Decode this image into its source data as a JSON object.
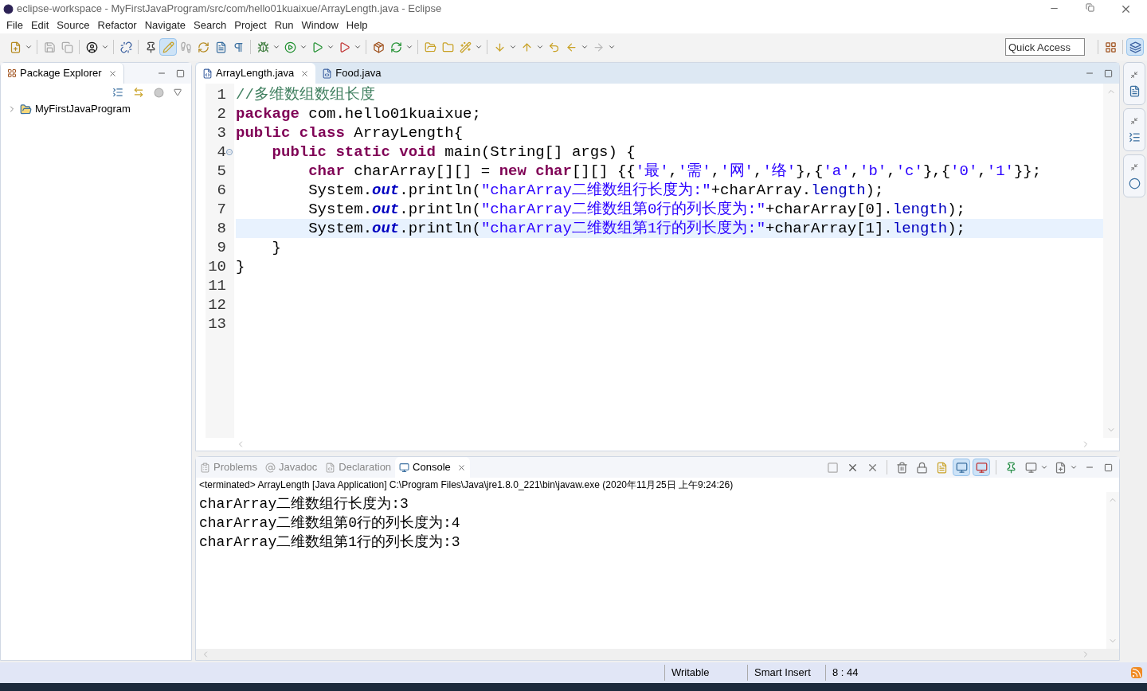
{
  "window": {
    "title": "eclipse-workspace - MyFirstJavaProgram/src/com/hello01kuaixue/ArrayLength.java - Eclipse"
  },
  "menu": [
    "File",
    "Edit",
    "Source",
    "Refactor",
    "Navigate",
    "Search",
    "Project",
    "Run",
    "Window",
    "Help"
  ],
  "quick_access": {
    "placeholder": "Quick Access"
  },
  "package_explorer": {
    "title": "Package Explorer",
    "tree": [
      {
        "label": "MyFirstJavaProgram",
        "expanded": false
      }
    ]
  },
  "editor": {
    "tabs": [
      {
        "label": "ArrayLength.java",
        "selected": true
      },
      {
        "label": "Food.java",
        "selected": false
      }
    ],
    "lines": [
      {
        "number": "1",
        "current": false,
        "foldable": false,
        "tokens": [
          {
            "kind": "comment",
            "text": "//多维数组数组长度"
          }
        ]
      },
      {
        "number": "2",
        "current": false,
        "foldable": false,
        "tokens": [
          {
            "kind": "keyword",
            "text": "package"
          },
          {
            "kind": "plain",
            "text": " com.hello01kuaixue;"
          }
        ]
      },
      {
        "number": "3",
        "current": false,
        "foldable": false,
        "tokens": [
          {
            "kind": "keyword",
            "text": "public"
          },
          {
            "kind": "keyword",
            "text": " class"
          },
          {
            "kind": "plain",
            "text": " ArrayLength{"
          }
        ]
      },
      {
        "number": "4",
        "current": false,
        "foldable": true,
        "tokens": [
          {
            "kind": "keyword",
            "text": "    public"
          },
          {
            "kind": "keyword",
            "text": " static"
          },
          {
            "kind": "keyword",
            "text": " void"
          },
          {
            "kind": "plain",
            "text": " main(String[] args) {"
          }
        ]
      },
      {
        "number": "5",
        "current": false,
        "foldable": false,
        "tokens": [
          {
            "kind": "keyword",
            "text": "        char"
          },
          {
            "kind": "plain",
            "text": " charArray[][] = "
          },
          {
            "kind": "keyword",
            "text": "new"
          },
          {
            "kind": "keyword",
            "text": " char"
          },
          {
            "kind": "plain",
            "text": "[][] {{"
          },
          {
            "kind": "string",
            "text": "'最'"
          },
          {
            "kind": "plain",
            "text": ","
          },
          {
            "kind": "string",
            "text": "'需'"
          },
          {
            "kind": "plain",
            "text": ","
          },
          {
            "kind": "string",
            "text": "'网'"
          },
          {
            "kind": "plain",
            "text": ","
          },
          {
            "kind": "string",
            "text": "'络'"
          },
          {
            "kind": "plain",
            "text": "},{"
          },
          {
            "kind": "string",
            "text": "'a'"
          },
          {
            "kind": "plain",
            "text": ","
          },
          {
            "kind": "string",
            "text": "'b'"
          },
          {
            "kind": "plain",
            "text": ","
          },
          {
            "kind": "string",
            "text": "'c'"
          },
          {
            "kind": "plain",
            "text": "},{"
          },
          {
            "kind": "string",
            "text": "'0'"
          },
          {
            "kind": "plain",
            "text": ","
          },
          {
            "kind": "string",
            "text": "'1'"
          },
          {
            "kind": "plain",
            "text": "}};"
          }
        ]
      },
      {
        "number": "6",
        "current": false,
        "foldable": false,
        "tokens": [
          {
            "kind": "plain",
            "text": "        System."
          },
          {
            "kind": "static_field",
            "text": "out"
          },
          {
            "kind": "plain",
            "text": ".println("
          },
          {
            "kind": "string",
            "text": "\"charArray二维数组行长度为:\""
          },
          {
            "kind": "plain",
            "text": "+charArray."
          },
          {
            "kind": "field",
            "text": "length"
          },
          {
            "kind": "plain",
            "text": ");"
          }
        ]
      },
      {
        "number": "7",
        "current": false,
        "foldable": false,
        "tokens": [
          {
            "kind": "plain",
            "text": "        System."
          },
          {
            "kind": "static_field",
            "text": "out"
          },
          {
            "kind": "plain",
            "text": ".println("
          },
          {
            "kind": "string",
            "text": "\"charArray二维数组第0行的列长度为:\""
          },
          {
            "kind": "plain",
            "text": "+charArray[0]."
          },
          {
            "kind": "field",
            "text": "length"
          },
          {
            "kind": "plain",
            "text": ");"
          }
        ]
      },
      {
        "number": "8",
        "current": true,
        "foldable": false,
        "tokens": [
          {
            "kind": "plain",
            "text": "        System."
          },
          {
            "kind": "static_field",
            "text": "out"
          },
          {
            "kind": "plain",
            "text": ".println("
          },
          {
            "kind": "string",
            "text": "\"charArray二维数组第1行的列长度为:\""
          },
          {
            "kind": "plain",
            "text": "+charArray[1]."
          },
          {
            "kind": "field",
            "text": "length"
          },
          {
            "kind": "plain",
            "text": ");"
          }
        ]
      },
      {
        "number": "9",
        "current": false,
        "foldable": false,
        "tokens": [
          {
            "kind": "plain",
            "text": "    }"
          }
        ]
      },
      {
        "number": "10",
        "current": false,
        "foldable": false,
        "tokens": [
          {
            "kind": "plain",
            "text": "}"
          }
        ]
      },
      {
        "number": "11",
        "current": false,
        "foldable": false
      },
      {
        "number": "12",
        "current": false,
        "foldable": false
      },
      {
        "number": "13",
        "current": false,
        "foldable": false
      }
    ]
  },
  "bottom_panel": {
    "tabs": [
      {
        "label": "Problems",
        "selected": false
      },
      {
        "label": "Javadoc",
        "selected": false
      },
      {
        "label": "Declaration",
        "selected": false
      },
      {
        "label": "Console",
        "selected": true
      }
    ],
    "status": "<terminated> ArrayLength [Java Application] C:\\Program Files\\Java\\jre1.8.0_221\\bin\\javaw.exe (2020年11月25日 上午9:24:26)",
    "output": [
      "charArray二维数组行长度为:3",
      "charArray二维数组第0行的列长度为:4",
      "charArray二维数组第1行的列长度为:3"
    ]
  },
  "status_bar": {
    "mode": "Writable",
    "insert_mode": "Smart Insert",
    "position": "8 : 44"
  }
}
